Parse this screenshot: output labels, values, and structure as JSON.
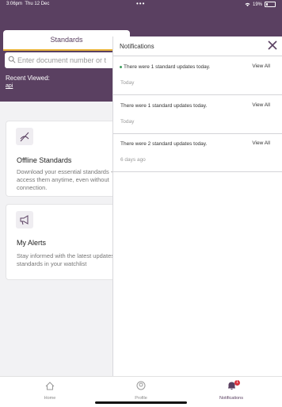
{
  "status_bar": {
    "time": "3:06pm",
    "date": "Thu 12 Dec",
    "wifi": "wifi-icon",
    "battery": "19%"
  },
  "tab": {
    "label": "Standards"
  },
  "search": {
    "placeholder": "Enter document number or t"
  },
  "recent": {
    "label": "Recent Viewed:",
    "items": [
      "api"
    ]
  },
  "cards": [
    {
      "icon": "offline-icon",
      "title": "Offline Standards",
      "desc": "Download your essential standards - access them anytime, even without connection."
    },
    {
      "icon": "megaphone-icon",
      "title": "My Alerts",
      "desc": "Stay informed with the latest updates on standards in your watchlist"
    }
  ],
  "notifications_panel": {
    "title": "Notifications",
    "items": [
      {
        "message": "There were 1 standard updates today.",
        "time": "Today",
        "action": "View All",
        "unread": true
      },
      {
        "message": "There were 1 standard updates today.",
        "time": "Today",
        "action": "View All",
        "unread": false
      },
      {
        "message": "There were 2 standard updates today.",
        "time": "6 days ago",
        "action": "View All",
        "unread": false
      }
    ]
  },
  "bottom_nav": [
    {
      "label": "Home",
      "icon": "home-icon"
    },
    {
      "label": "Profile",
      "icon": "profile-icon"
    },
    {
      "label": "Notifications",
      "icon": "bell-icon",
      "badge": "1"
    }
  ],
  "colors": {
    "brand": "#5a4061",
    "accent": "#e9b43a",
    "badge": "#d9303c"
  }
}
